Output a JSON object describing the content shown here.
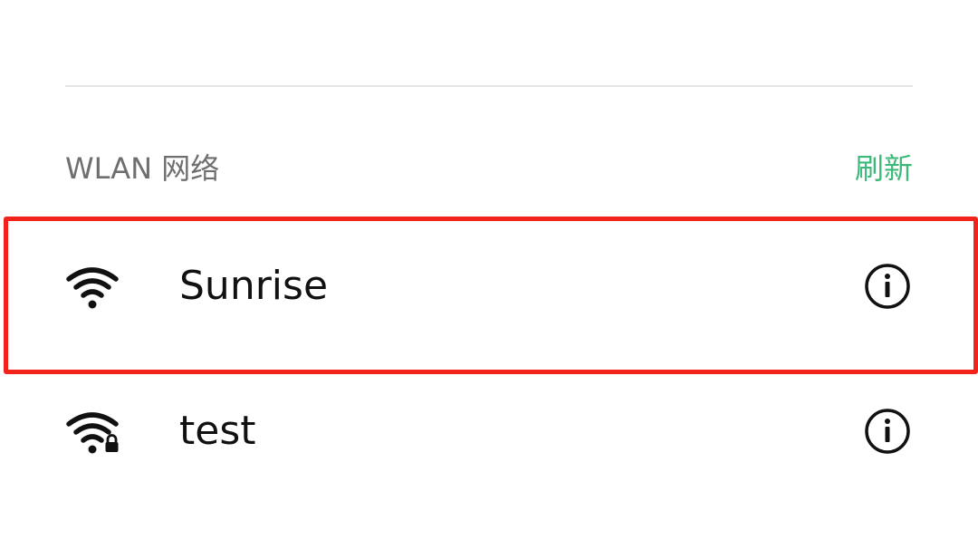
{
  "section": {
    "title": "WLAN 网络",
    "refresh_label": "刷新"
  },
  "networks": [
    {
      "name": "Sunrise",
      "secured": false,
      "signal_icon": "wifi-full-icon",
      "info_icon": "info-icon"
    },
    {
      "name": "test",
      "secured": true,
      "signal_icon": "wifi-lock-icon",
      "info_icon": "info-icon"
    }
  ],
  "colors": {
    "accent": "#3cb878",
    "highlight_border": "#f2231b",
    "secondary_text": "#6f6f6f",
    "primary_text": "#111111",
    "divider": "#e3e3e3"
  }
}
